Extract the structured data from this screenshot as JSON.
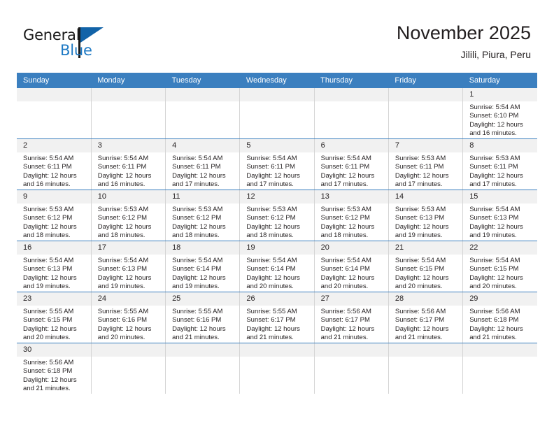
{
  "brand": {
    "line1": "General",
    "line2": "Blue",
    "flag_color": "#1263a8",
    "blue_color": "#1f7ac4"
  },
  "header": {
    "title": "November 2025",
    "subtitle": "Jilili, Piura, Peru"
  },
  "theme": {
    "header_blue": "#3b7fbf",
    "daynum_gray": "#f1f1f1",
    "text": "#231f20"
  },
  "weekday_headers": [
    "Sunday",
    "Monday",
    "Tuesday",
    "Wednesday",
    "Thursday",
    "Friday",
    "Saturday"
  ],
  "weeks": [
    [
      {
        "day": "",
        "lines": []
      },
      {
        "day": "",
        "lines": []
      },
      {
        "day": "",
        "lines": []
      },
      {
        "day": "",
        "lines": []
      },
      {
        "day": "",
        "lines": []
      },
      {
        "day": "",
        "lines": []
      },
      {
        "day": "1",
        "lines": [
          "Sunrise: 5:54 AM",
          "Sunset: 6:10 PM",
          "Daylight: 12 hours",
          "and 16 minutes."
        ]
      }
    ],
    [
      {
        "day": "2",
        "lines": [
          "Sunrise: 5:54 AM",
          "Sunset: 6:11 PM",
          "Daylight: 12 hours",
          "and 16 minutes."
        ]
      },
      {
        "day": "3",
        "lines": [
          "Sunrise: 5:54 AM",
          "Sunset: 6:11 PM",
          "Daylight: 12 hours",
          "and 16 minutes."
        ]
      },
      {
        "day": "4",
        "lines": [
          "Sunrise: 5:54 AM",
          "Sunset: 6:11 PM",
          "Daylight: 12 hours",
          "and 17 minutes."
        ]
      },
      {
        "day": "5",
        "lines": [
          "Sunrise: 5:54 AM",
          "Sunset: 6:11 PM",
          "Daylight: 12 hours",
          "and 17 minutes."
        ]
      },
      {
        "day": "6",
        "lines": [
          "Sunrise: 5:54 AM",
          "Sunset: 6:11 PM",
          "Daylight: 12 hours",
          "and 17 minutes."
        ]
      },
      {
        "day": "7",
        "lines": [
          "Sunrise: 5:53 AM",
          "Sunset: 6:11 PM",
          "Daylight: 12 hours",
          "and 17 minutes."
        ]
      },
      {
        "day": "8",
        "lines": [
          "Sunrise: 5:53 AM",
          "Sunset: 6:11 PM",
          "Daylight: 12 hours",
          "and 17 minutes."
        ]
      }
    ],
    [
      {
        "day": "9",
        "lines": [
          "Sunrise: 5:53 AM",
          "Sunset: 6:12 PM",
          "Daylight: 12 hours",
          "and 18 minutes."
        ]
      },
      {
        "day": "10",
        "lines": [
          "Sunrise: 5:53 AM",
          "Sunset: 6:12 PM",
          "Daylight: 12 hours",
          "and 18 minutes."
        ]
      },
      {
        "day": "11",
        "lines": [
          "Sunrise: 5:53 AM",
          "Sunset: 6:12 PM",
          "Daylight: 12 hours",
          "and 18 minutes."
        ]
      },
      {
        "day": "12",
        "lines": [
          "Sunrise: 5:53 AM",
          "Sunset: 6:12 PM",
          "Daylight: 12 hours",
          "and 18 minutes."
        ]
      },
      {
        "day": "13",
        "lines": [
          "Sunrise: 5:53 AM",
          "Sunset: 6:12 PM",
          "Daylight: 12 hours",
          "and 18 minutes."
        ]
      },
      {
        "day": "14",
        "lines": [
          "Sunrise: 5:53 AM",
          "Sunset: 6:13 PM",
          "Daylight: 12 hours",
          "and 19 minutes."
        ]
      },
      {
        "day": "15",
        "lines": [
          "Sunrise: 5:54 AM",
          "Sunset: 6:13 PM",
          "Daylight: 12 hours",
          "and 19 minutes."
        ]
      }
    ],
    [
      {
        "day": "16",
        "lines": [
          "Sunrise: 5:54 AM",
          "Sunset: 6:13 PM",
          "Daylight: 12 hours",
          "and 19 minutes."
        ]
      },
      {
        "day": "17",
        "lines": [
          "Sunrise: 5:54 AM",
          "Sunset: 6:13 PM",
          "Daylight: 12 hours",
          "and 19 minutes."
        ]
      },
      {
        "day": "18",
        "lines": [
          "Sunrise: 5:54 AM",
          "Sunset: 6:14 PM",
          "Daylight: 12 hours",
          "and 19 minutes."
        ]
      },
      {
        "day": "19",
        "lines": [
          "Sunrise: 5:54 AM",
          "Sunset: 6:14 PM",
          "Daylight: 12 hours",
          "and 20 minutes."
        ]
      },
      {
        "day": "20",
        "lines": [
          "Sunrise: 5:54 AM",
          "Sunset: 6:14 PM",
          "Daylight: 12 hours",
          "and 20 minutes."
        ]
      },
      {
        "day": "21",
        "lines": [
          "Sunrise: 5:54 AM",
          "Sunset: 6:15 PM",
          "Daylight: 12 hours",
          "and 20 minutes."
        ]
      },
      {
        "day": "22",
        "lines": [
          "Sunrise: 5:54 AM",
          "Sunset: 6:15 PM",
          "Daylight: 12 hours",
          "and 20 minutes."
        ]
      }
    ],
    [
      {
        "day": "23",
        "lines": [
          "Sunrise: 5:55 AM",
          "Sunset: 6:15 PM",
          "Daylight: 12 hours",
          "and 20 minutes."
        ]
      },
      {
        "day": "24",
        "lines": [
          "Sunrise: 5:55 AM",
          "Sunset: 6:16 PM",
          "Daylight: 12 hours",
          "and 20 minutes."
        ]
      },
      {
        "day": "25",
        "lines": [
          "Sunrise: 5:55 AM",
          "Sunset: 6:16 PM",
          "Daylight: 12 hours",
          "and 21 minutes."
        ]
      },
      {
        "day": "26",
        "lines": [
          "Sunrise: 5:55 AM",
          "Sunset: 6:17 PM",
          "Daylight: 12 hours",
          "and 21 minutes."
        ]
      },
      {
        "day": "27",
        "lines": [
          "Sunrise: 5:56 AM",
          "Sunset: 6:17 PM",
          "Daylight: 12 hours",
          "and 21 minutes."
        ]
      },
      {
        "day": "28",
        "lines": [
          "Sunrise: 5:56 AM",
          "Sunset: 6:17 PM",
          "Daylight: 12 hours",
          "and 21 minutes."
        ]
      },
      {
        "day": "29",
        "lines": [
          "Sunrise: 5:56 AM",
          "Sunset: 6:18 PM",
          "Daylight: 12 hours",
          "and 21 minutes."
        ]
      }
    ],
    [
      {
        "day": "30",
        "lines": [
          "Sunrise: 5:56 AM",
          "Sunset: 6:18 PM",
          "Daylight: 12 hours",
          "and 21 minutes."
        ]
      },
      {
        "day": "",
        "lines": []
      },
      {
        "day": "",
        "lines": []
      },
      {
        "day": "",
        "lines": []
      },
      {
        "day": "",
        "lines": []
      },
      {
        "day": "",
        "lines": []
      },
      {
        "day": "",
        "lines": []
      }
    ]
  ]
}
